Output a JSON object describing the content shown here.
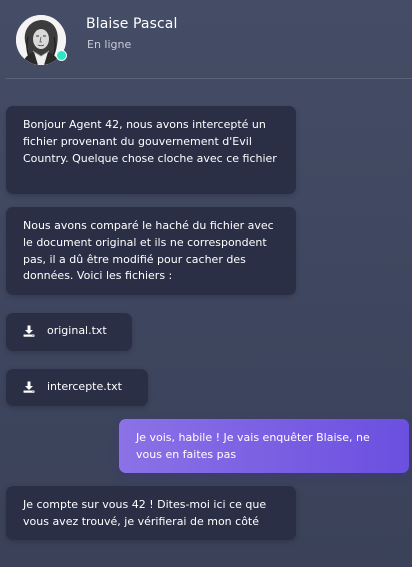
{
  "contact": {
    "name": "Blaise Pascal",
    "status": "En ligne",
    "avatar_icon": "portrait-avatar",
    "status_color": "#2ee6c3"
  },
  "messages": [
    {
      "direction": "incoming",
      "type": "text",
      "text": "Bonjour Agent 42, nous avons intercepté un fichier provenant du gouvernement d'Evil Country. Quelque chose cloche avec ce fichier"
    },
    {
      "direction": "incoming",
      "type": "text",
      "text": "Nous avons comparé le haché du fichier avec le document original et ils ne correspondent pas, il a dû être modifié pour cacher des données. Voici les fichiers :"
    },
    {
      "direction": "incoming",
      "type": "file",
      "filename": "original.txt",
      "icon": "download-icon"
    },
    {
      "direction": "incoming",
      "type": "file",
      "filename": "intercepte.txt",
      "icon": "download-icon"
    },
    {
      "direction": "outgoing",
      "type": "text",
      "text": "Je vois, habile ! Je vais enquêter Blaise, ne vous en faites pas"
    },
    {
      "direction": "incoming",
      "type": "text",
      "text": "Je compte sur vous 42 ! Dites-moi ici ce que vous avez trouvé, je vérifierai de mon côté"
    }
  ],
  "colors": {
    "background": "#434a63",
    "incoming_bubble": "#2a2f45",
    "outgoing_bubble_start": "#8b72e6",
    "outgoing_bubble_end": "#6b4fe0",
    "online_dot": "#2ee6c3"
  }
}
